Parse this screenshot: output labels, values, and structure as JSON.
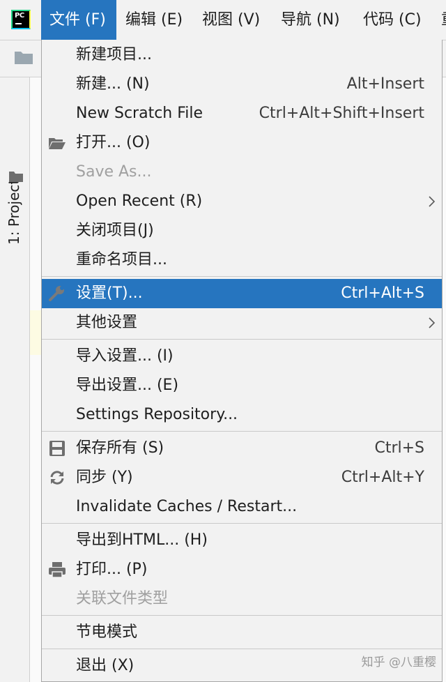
{
  "menubar": {
    "items": [
      {
        "label": "文件 (F)",
        "active": true
      },
      {
        "label": "编辑 (E)"
      },
      {
        "label": "视图 (V)"
      },
      {
        "label": "导航 (N)"
      },
      {
        "label": "代码 (C)"
      },
      {
        "label": "重"
      }
    ]
  },
  "app_logo_text": "PC",
  "side": {
    "project_tab": "1: Project"
  },
  "file_menu": {
    "items": [
      {
        "label": "新建项目...",
        "shortcut": ""
      },
      {
        "label": "新建... (N)",
        "shortcut": "Alt+Insert"
      },
      {
        "label": "New Scratch File",
        "shortcut": "Ctrl+Alt+Shift+Insert"
      },
      {
        "label": "打开... (O)",
        "shortcut": "",
        "icon": "folder-open-icon"
      },
      {
        "label": "Save As...",
        "shortcut": "",
        "disabled": true
      },
      {
        "label": "Open Recent (R)",
        "shortcut": "",
        "submenu": true
      },
      {
        "label": "关闭项目(J)",
        "shortcut": ""
      },
      {
        "label": "重命名项目...",
        "shortcut": ""
      },
      {
        "label": "设置(T)...",
        "shortcut": "Ctrl+Alt+S",
        "icon": "wrench-icon",
        "highlighted": true
      },
      {
        "label": "其他设置",
        "shortcut": "",
        "submenu": true
      },
      {
        "label": "导入设置... (I)",
        "shortcut": ""
      },
      {
        "label": "导出设置... (E)",
        "shortcut": ""
      },
      {
        "label": "Settings Repository...",
        "shortcut": ""
      },
      {
        "label": "保存所有 (S)",
        "shortcut": "Ctrl+S",
        "icon": "save-icon"
      },
      {
        "label": "同步 (Y)",
        "shortcut": "Ctrl+Alt+Y",
        "icon": "sync-icon"
      },
      {
        "label": "Invalidate Caches / Restart...",
        "shortcut": ""
      },
      {
        "label": "导出到HTML... (H)",
        "shortcut": ""
      },
      {
        "label": "打印... (P)",
        "shortcut": "",
        "icon": "printer-icon"
      },
      {
        "label": "关联文件类型",
        "shortcut": "",
        "disabled": true
      },
      {
        "label": "节电模式",
        "shortcut": ""
      },
      {
        "label": "退出 (X)",
        "shortcut": ""
      }
    ]
  },
  "watermark": "知乎 @八重樱",
  "colors": {
    "highlight": "#2675bf",
    "menu_bg": "#f2f2f2",
    "disabled_text": "#a0a0a0"
  }
}
